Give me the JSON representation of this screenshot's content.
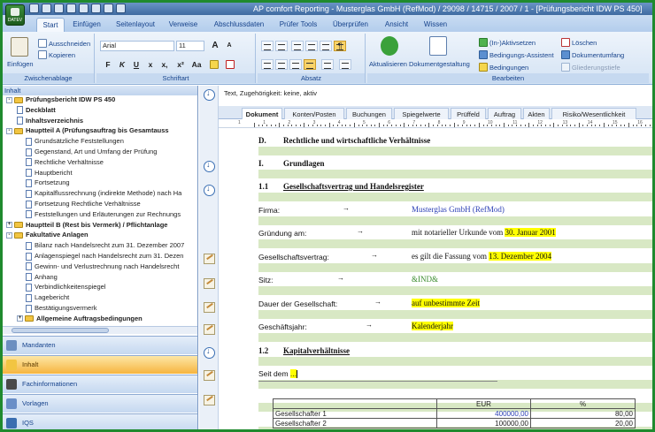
{
  "window": {
    "title": "AP comfort Reporting - Musterglas GmbH (RefMod) / 29098 / 14715 / 2007 / 1 - [Prüfungsbericht IDW PS 450]",
    "app_button_label": "DATEV"
  },
  "ribbon": {
    "tabs": [
      "Start",
      "Einfügen",
      "Seitenlayout",
      "Verweise",
      "Abschlussdaten",
      "Prüfer Tools",
      "Überprüfen",
      "Ansicht",
      "Wissen"
    ],
    "clipboard": {
      "paste": "Einfügen",
      "cut": "Ausschneiden",
      "copy": "Kopieren",
      "group_label": "Zwischenablage"
    },
    "font": {
      "name": "Arial",
      "size": "11",
      "group_label": "Schriftart",
      "bold": "F",
      "italic": "K",
      "underline": "U",
      "strike": "x",
      "sub": "x,",
      "sup": "x²",
      "case": "Aa",
      "grow": "A",
      "shrink": "A"
    },
    "paragraph": {
      "group_label": "Absatz",
      "show_marks": "¶"
    },
    "edit": {
      "refresh": "Aktualisieren",
      "design": "Dokumentgestaltung",
      "group_label": "Bearbeiten",
      "activate": "(In-)Aktivsetzen",
      "cond_assistant": "Bedingungs-Assistent",
      "conditions": "Bedingungen",
      "delete": "Löschen",
      "doc_scope": "Dokumentumfang",
      "structure_depth": "Gliederungstiefe"
    }
  },
  "tree": {
    "panel_title": "Inhalt",
    "nodes": [
      {
        "label": "Prüfungsbericht IDW PS 450",
        "kind": "folder",
        "bold": true,
        "toggle": "-"
      },
      {
        "label": "Deckblatt",
        "kind": "doc",
        "bold": true
      },
      {
        "label": "Inhaltsverzeichnis",
        "kind": "doc",
        "bold": true
      },
      {
        "label": "Hauptteil A (Prüfungsauftrag bis Gesamtauss",
        "kind": "folder",
        "bold": true,
        "toggle": "-"
      },
      {
        "label": "Grundsätzliche Feststellungen",
        "kind": "doc",
        "bold": false
      },
      {
        "label": "Gegenstand, Art und Umfang der Prüfung",
        "kind": "doc",
        "bold": false
      },
      {
        "label": "Rechtliche Verhältnisse",
        "kind": "doc",
        "bold": false
      },
      {
        "label": "Hauptbericht",
        "kind": "doc",
        "bold": false
      },
      {
        "label": "Fortsetzung",
        "kind": "doc",
        "bold": false
      },
      {
        "label": "Kapitalflussrechnung (indirekte Methode) nach Ha",
        "kind": "doc",
        "bold": false
      },
      {
        "label": "Fortsetzung Rechtliche Verhältnisse",
        "kind": "doc",
        "bold": false
      },
      {
        "label": "Feststellungen und Erläuterungen zur Rechnungs",
        "kind": "doc",
        "bold": false
      },
      {
        "label": "Hauptteil B (Rest bis Vermerk) / Pflichtanlage",
        "kind": "folder",
        "bold": true,
        "toggle": "+"
      },
      {
        "label": "Fakultative Anlagen",
        "kind": "folder",
        "bold": true,
        "toggle": "-"
      },
      {
        "label": "Bilanz nach Handelsrecht zum 31. Dezember 2007",
        "kind": "doc",
        "bold": false
      },
      {
        "label": "Anlagenspiegel nach Handelsrecht zum 31. Dezen",
        "kind": "doc",
        "bold": false
      },
      {
        "label": "Gewinn- und Verlustrechnung nach Handelsrecht",
        "kind": "doc",
        "bold": false
      },
      {
        "label": "Anhang",
        "kind": "doc",
        "bold": false
      },
      {
        "label": "Verbindlichkeitenspiegel",
        "kind": "doc",
        "bold": false
      },
      {
        "label": "Lagebericht",
        "kind": "doc",
        "bold": false
      },
      {
        "label": "Bestätigungsvermerk",
        "kind": "doc",
        "bold": false
      },
      {
        "label": "Allgemeine Auftragsbedingungen",
        "kind": "folder",
        "bold": true,
        "toggle": "+"
      }
    ]
  },
  "nav": [
    "Mandanten",
    "Inhalt",
    "Fachinformationen",
    "Vorlagen",
    "IQS"
  ],
  "editor": {
    "hint": "Text, Zugehörigkeit: keine, aktiv",
    "tabs": [
      "Dokument",
      "Konten/Posten",
      "Buchungen",
      "Spiegelwerte",
      "Prüffeld",
      "Auftrag",
      "Akten",
      "Risiko/Wesentlichkeit"
    ],
    "ruler_numbers": [
      "1",
      "1",
      "2",
      "3",
      "4",
      "5",
      "6",
      "7",
      "8",
      "9",
      "10",
      "11",
      "12",
      "13",
      "14",
      "15",
      "16"
    ],
    "heading_d_num": "D.",
    "heading_d": "Rechtliche und wirtschaftliche Verhältnisse",
    "heading_i_num": "I.",
    "heading_i": "Grundlagen",
    "heading_11_num": "1.1",
    "heading_11": "Gesellschaftsvertrag und Handelsregister",
    "firma_label": "Firma:",
    "firma_value": "Musterglas GmbH (RefMod)",
    "gruendung_label": "Gründung am:",
    "gruendung_text": "mit notarieller Urkunde vom",
    "gruendung_date": "30. Januar 2001",
    "vertrag_label": "Gesellschaftsvertrag:",
    "vertrag_text": "es gilt die Fassung vom",
    "vertrag_date": "13. Dezember 2004",
    "sitz_label": "Sitz:",
    "sitz_value": "&IND&",
    "dauer_label": "Dauer der Gesellschaft:",
    "dauer_value": "auf unbestimmte Zeit",
    "gj_label": "Geschäftsjahr:",
    "gj_value": "Kalenderjahr",
    "heading_12_num": "1.2",
    "heading_12": "Kapitalverhältnisse",
    "seit_text": "Seit dem",
    "seit_placeholder": "...",
    "arrow": "→"
  },
  "capital_table": {
    "headers": [
      "",
      "EUR",
      "%"
    ],
    "rows": [
      [
        "Gesellschafter 1",
        "400000,00",
        "80,00"
      ],
      [
        "Gesellschafter 2",
        "100000,00",
        "20,00"
      ]
    ]
  },
  "colors": {
    "accent": "#15428b",
    "highlight": "#ffff00",
    "band": "#d8e8c4",
    "link_blue": "#2b3fb5",
    "field_green": "#3b8c2e"
  }
}
